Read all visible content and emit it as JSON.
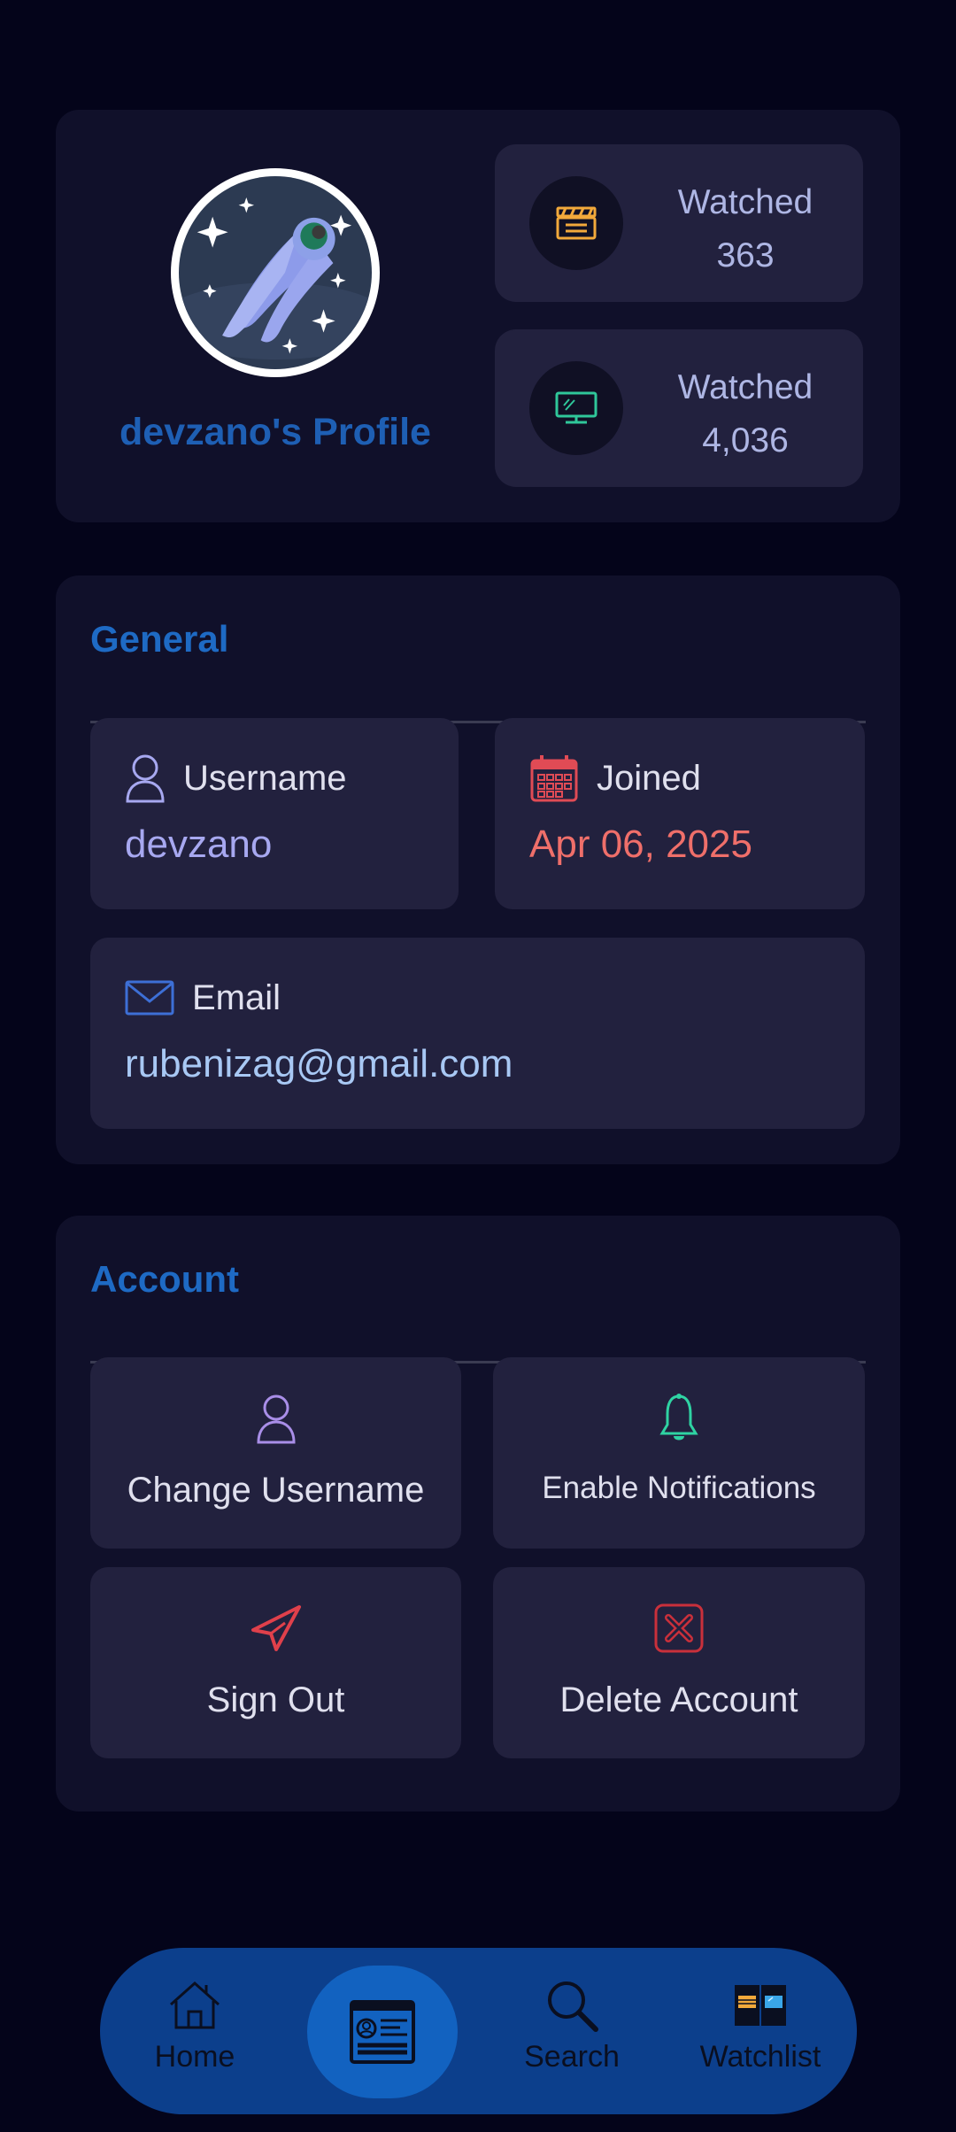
{
  "profile": {
    "name": "devzano's Profile",
    "stats": [
      {
        "label": "Watched",
        "value": "363",
        "icon": "clapperboard-icon",
        "color": "#f2a93b"
      },
      {
        "label": "Watched",
        "value": "4,036",
        "icon": "tv-icon",
        "color": "#2fc79a"
      }
    ]
  },
  "general": {
    "title": "General",
    "username": {
      "label": "Username",
      "value": "devzano",
      "icon": "user-icon",
      "color": "#a7a8f0"
    },
    "joined": {
      "label": "Joined",
      "value": "Apr 06, 2025",
      "icon": "calendar-icon",
      "color": "#ef6f6a"
    },
    "email": {
      "label": "Email",
      "value": "rubenizag@gmail.com",
      "icon": "mail-icon",
      "color": "#a8c8f4"
    }
  },
  "account": {
    "title": "Account",
    "change_username": "Change Username",
    "enable_notifications": "Enable Notifications",
    "sign_out": "Sign Out",
    "delete_account": "Delete Account"
  },
  "nav": {
    "home": "Home",
    "search": "Search",
    "watchlist": "Watchlist",
    "active": "profile"
  }
}
